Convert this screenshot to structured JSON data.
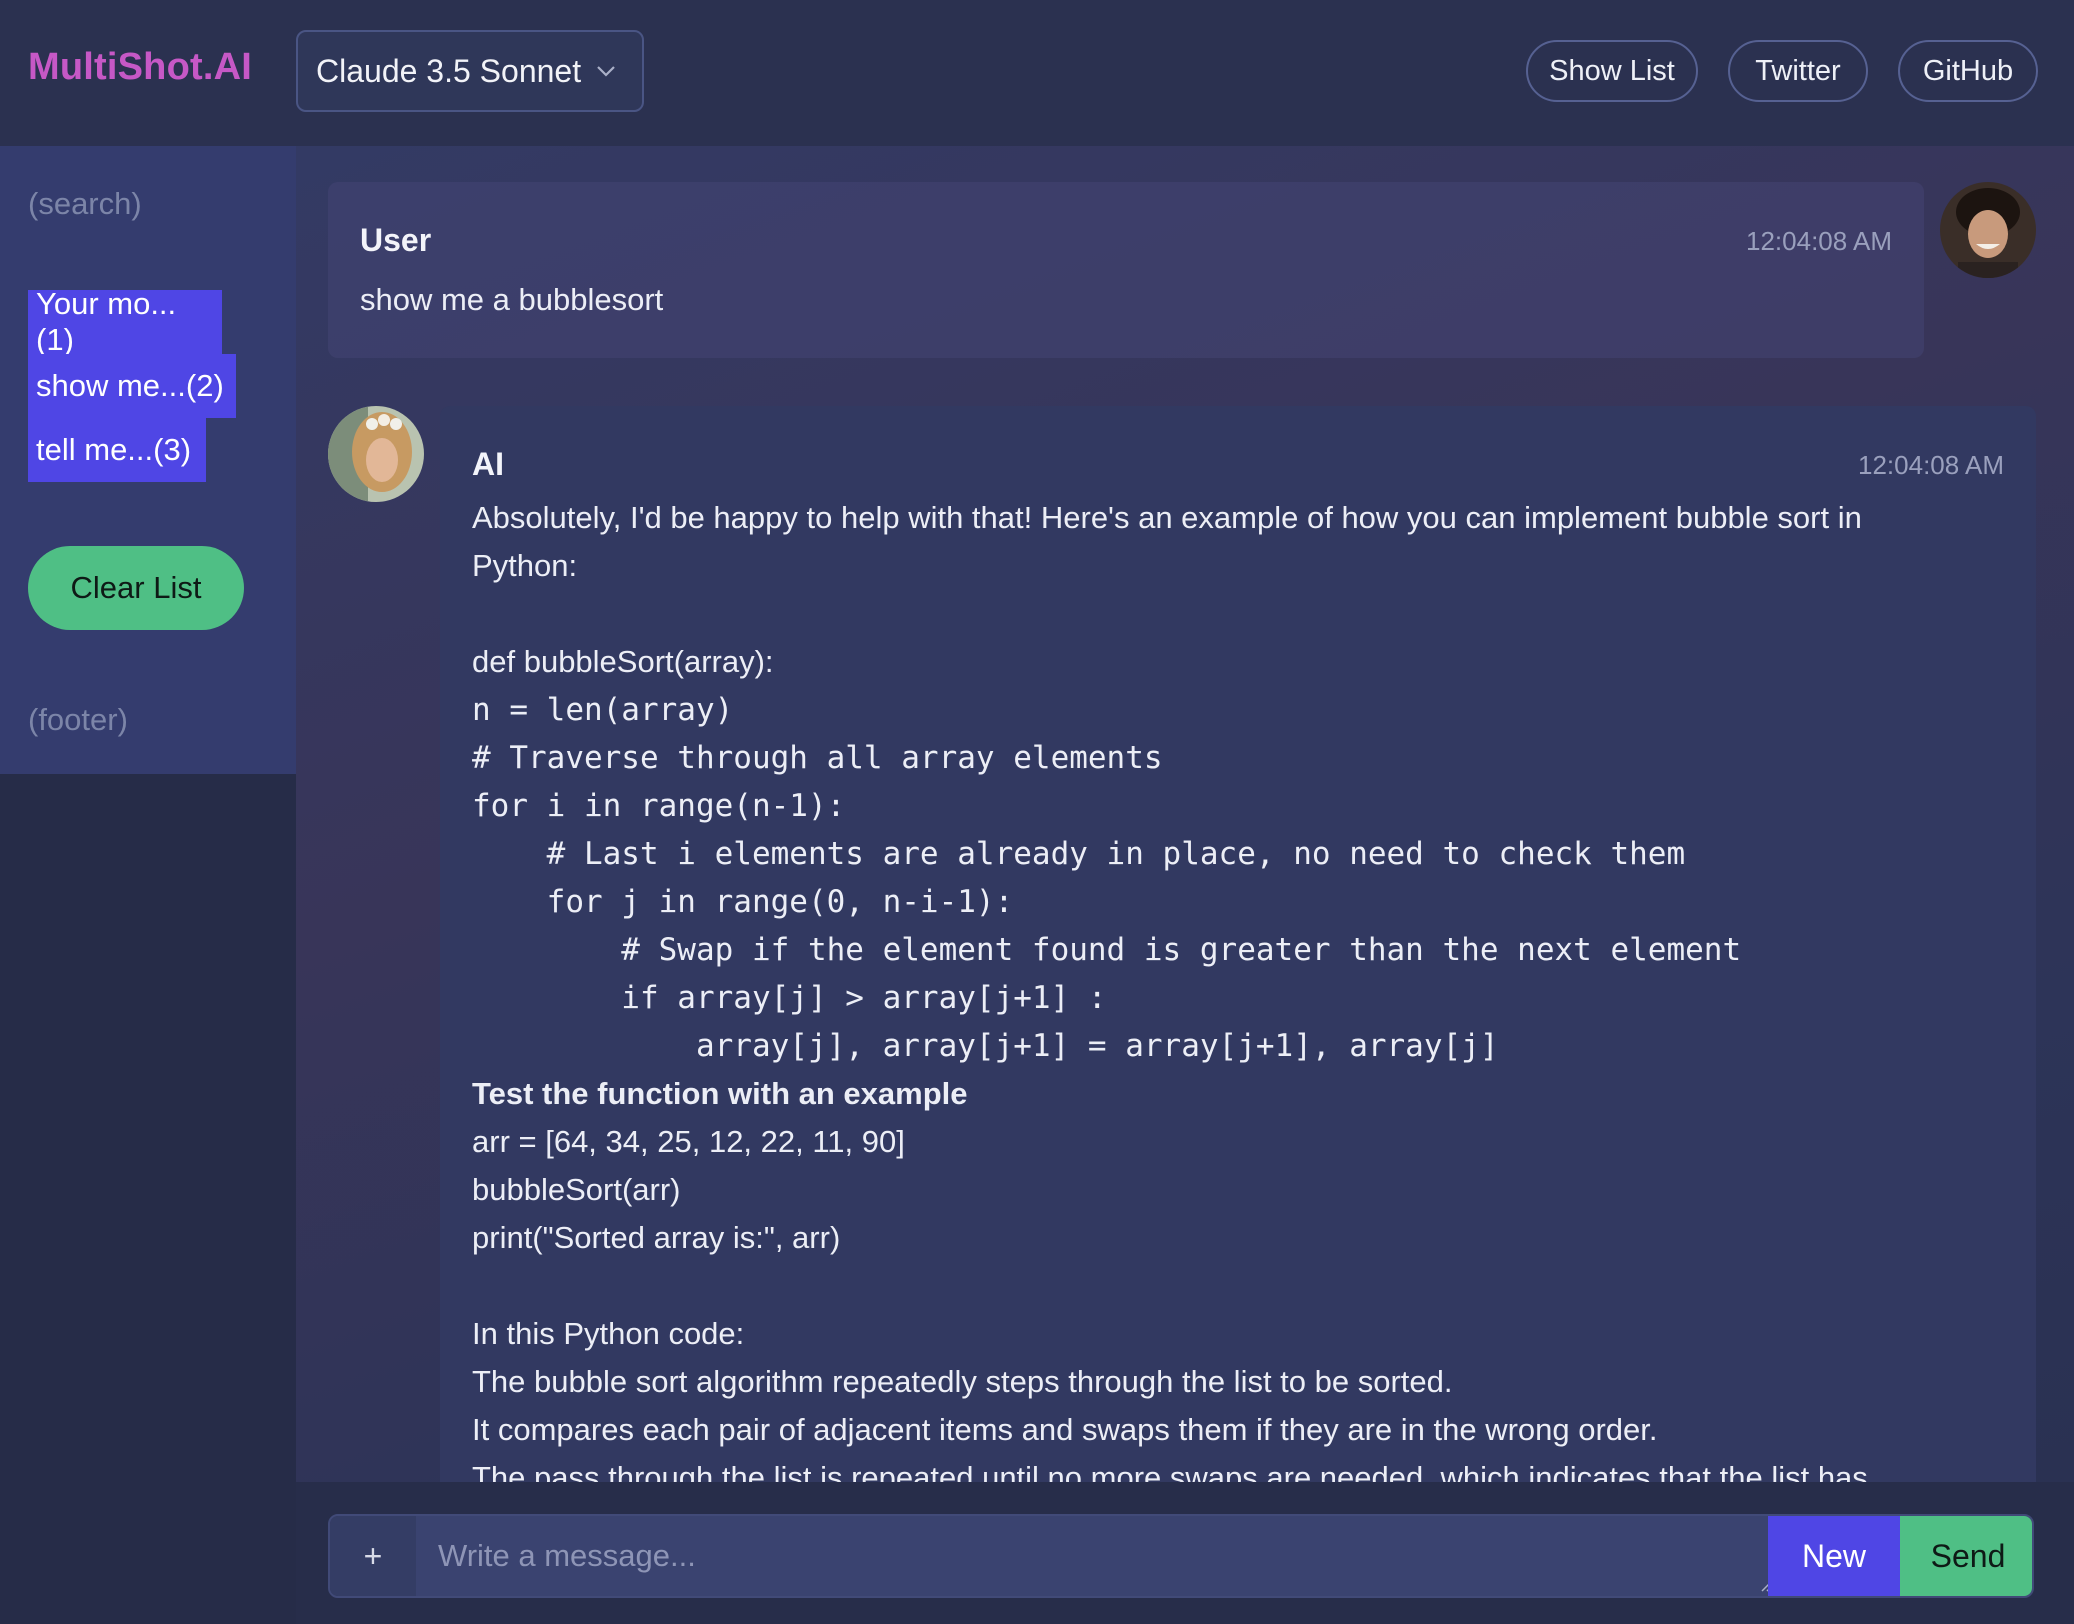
{
  "header": {
    "brand": "MultiShot.AI",
    "model": "Claude 3.5 Sonnet",
    "model_chevron_icon": "chevron-down-icon",
    "buttons": {
      "show_list": "Show List",
      "twitter": "Twitter",
      "github": "GitHub"
    }
  },
  "sidebar": {
    "search": "(search)",
    "history": [
      {
        "label": "Your mo...(1)"
      },
      {
        "label": "show me...(2)"
      },
      {
        "label": "tell me...(3)"
      }
    ],
    "clear_label": "Clear List",
    "footer": "(footer)"
  },
  "chat": {
    "user": {
      "role": "User",
      "time": "12:04:08 AM",
      "text": "show me a bubblesort",
      "avatar_icon": "user-avatar"
    },
    "ai": {
      "role": "AI",
      "time": "12:04:08 AM",
      "avatar_icon": "ai-avatar",
      "lines": [
        "Absolutely, I'd be happy to help with that! Here's an example of how you can implement bubble sort in",
        "Python:",
        "",
        "def bubbleSort(array):",
        "n = len(array)",
        "# Traverse through all array elements",
        "for i in range(n-1):",
        "    # Last i elements are already in place, no need to check them",
        "    for j in range(0, n-i-1):",
        "        # Swap if the element found is greater than the next element",
        "        if array[j] > array[j+1] :",
        "            array[j], array[j+1] = array[j+1], array[j]",
        "Test the function with an example",
        "arr = [64, 34, 25, 12, 22, 11, 90]",
        "bubbleSort(arr)",
        "print(\"Sorted array is:\", arr)",
        "",
        "In this Python code:",
        "The bubble sort algorithm repeatedly steps through the list to be sorted.",
        "It compares each pair of adjacent items and swaps them if they are in the wrong order.",
        "The pass through the list is repeated until no more swaps are needed, which indicates that the list has"
      ]
    }
  },
  "composer": {
    "plus_label": "+",
    "placeholder": "Write a message...",
    "new_label": "New",
    "send_label": "Send"
  },
  "colors": {
    "brand": "#c658c6",
    "accent_blue": "#4f46e5",
    "accent_green": "#4fbf85"
  }
}
